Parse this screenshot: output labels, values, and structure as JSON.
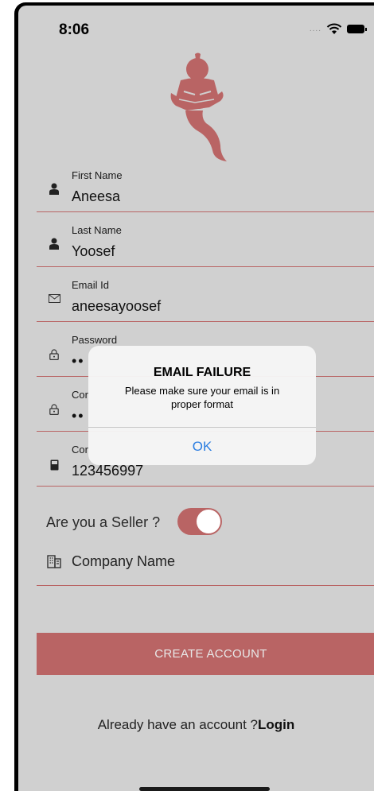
{
  "status_bar": {
    "time": "8:06"
  },
  "form": {
    "first_name": {
      "label": "First Name",
      "value": "Aneesa"
    },
    "last_name": {
      "label": "Last Name",
      "value": "Yoosef"
    },
    "email": {
      "label": "Email Id",
      "value": "aneesayoosef"
    },
    "password": {
      "label": "Password",
      "value": "••"
    },
    "confirm_password": {
      "label": "Cor",
      "value": "••"
    },
    "contact": {
      "label": "Cor",
      "value": "123456997"
    },
    "seller": {
      "label": "Are you a Seller ?",
      "enabled": true
    },
    "company": {
      "placeholder": "Company Name"
    },
    "create_button": "CREATE ACCOUNT",
    "login_prompt": "Already have an account ?",
    "login_link": "Login"
  },
  "alert": {
    "title": "EMAIL FAILURE",
    "message": "Please make sure your email is in proper format",
    "ok_label": "OK"
  },
  "colors": {
    "accent": "#b96464",
    "background": "#d0d0d0",
    "link_blue": "#2a7de1"
  },
  "icons": [
    "user-icon",
    "mail-icon",
    "lock-icon",
    "phone-icon",
    "building-icon",
    "genie-logo"
  ]
}
